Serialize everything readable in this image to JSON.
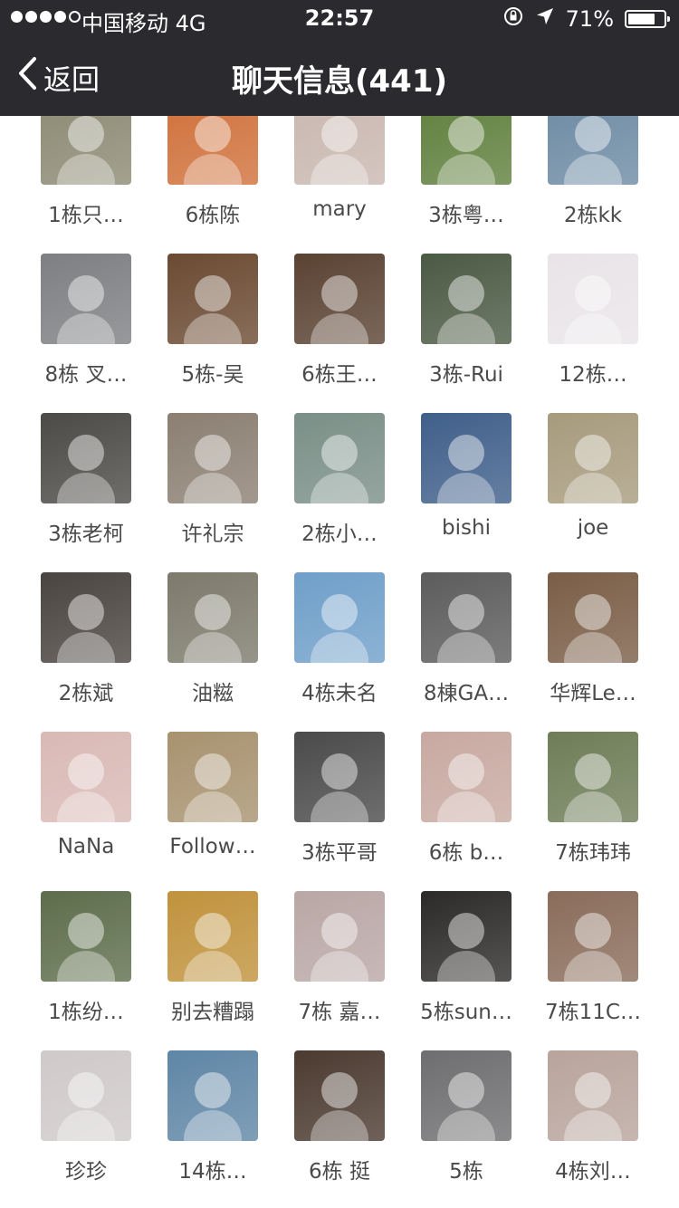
{
  "status_bar": {
    "carrier": "中国移动 4G",
    "time": "22:57",
    "battery": "71%",
    "signal_level": 4,
    "icons": [
      "rotation-lock-icon",
      "location-arrow-icon",
      "battery-icon"
    ]
  },
  "nav": {
    "back_label": "返回",
    "title": "聊天信息(441)"
  },
  "members": [
    {
      "name": "1栋只…",
      "color": "#8c8a73"
    },
    {
      "name": "6栋陈",
      "color": "#d0703a"
    },
    {
      "name": "mary",
      "color": "#c9b7b0"
    },
    {
      "name": "3栋粤…",
      "color": "#5f7f3c"
    },
    {
      "name": "2栋kk",
      "color": "#6c8aa3"
    },
    {
      "name": "8栋 叉…",
      "color": "#7d7f82"
    },
    {
      "name": "5栋-吴",
      "color": "#6b4a32"
    },
    {
      "name": "6栋王…",
      "color": "#5a4232"
    },
    {
      "name": "3栋-Rui",
      "color": "#4b5a44"
    },
    {
      "name": "12栋…",
      "color": "#e9e4e8"
    },
    {
      "name": "3栋老柯",
      "color": "#4c4a46"
    },
    {
      "name": "许礼宗",
      "color": "#8b7f72"
    },
    {
      "name": "2栋小…",
      "color": "#7a8f87"
    },
    {
      "name": "bishi",
      "color": "#3f5f8a"
    },
    {
      "name": "joe",
      "color": "#a79b7d"
    },
    {
      "name": "2栋斌",
      "color": "#4a4440"
    },
    {
      "name": "油糍",
      "color": "#7d7a6c"
    },
    {
      "name": "4栋未名",
      "color": "#6f9fc9"
    },
    {
      "name": "8棟GA…",
      "color": "#5c5c5c"
    },
    {
      "name": "华辉Le…",
      "color": "#7a5d46"
    },
    {
      "name": "NaNa",
      "color": "#d9b9b5"
    },
    {
      "name": "Follow…",
      "color": "#a8926f"
    },
    {
      "name": "3栋平哥",
      "color": "#4a4a4a"
    },
    {
      "name": "6栋 b…",
      "color": "#c8a9a1"
    },
    {
      "name": "7栋玮玮",
      "color": "#6e7d57"
    },
    {
      "name": "1栋纷…",
      "color": "#5d6d4b"
    },
    {
      "name": "别去糟蹋",
      "color": "#c0923c"
    },
    {
      "name": "7栋 嘉…",
      "color": "#b9a7a5"
    },
    {
      "name": "5栋sun…",
      "color": "#2c2a28"
    },
    {
      "name": "7栋11C…",
      "color": "#8a6c5a"
    },
    {
      "name": "珍珍",
      "color": "#cfcac9"
    },
    {
      "name": "14栋…",
      "color": "#5f86a6"
    },
    {
      "name": "6栋 挺",
      "color": "#4b3a30"
    },
    {
      "name": "5栋",
      "color": "#6e6e70"
    },
    {
      "name": "4栋刘…",
      "color": "#b8a49c"
    }
  ]
}
